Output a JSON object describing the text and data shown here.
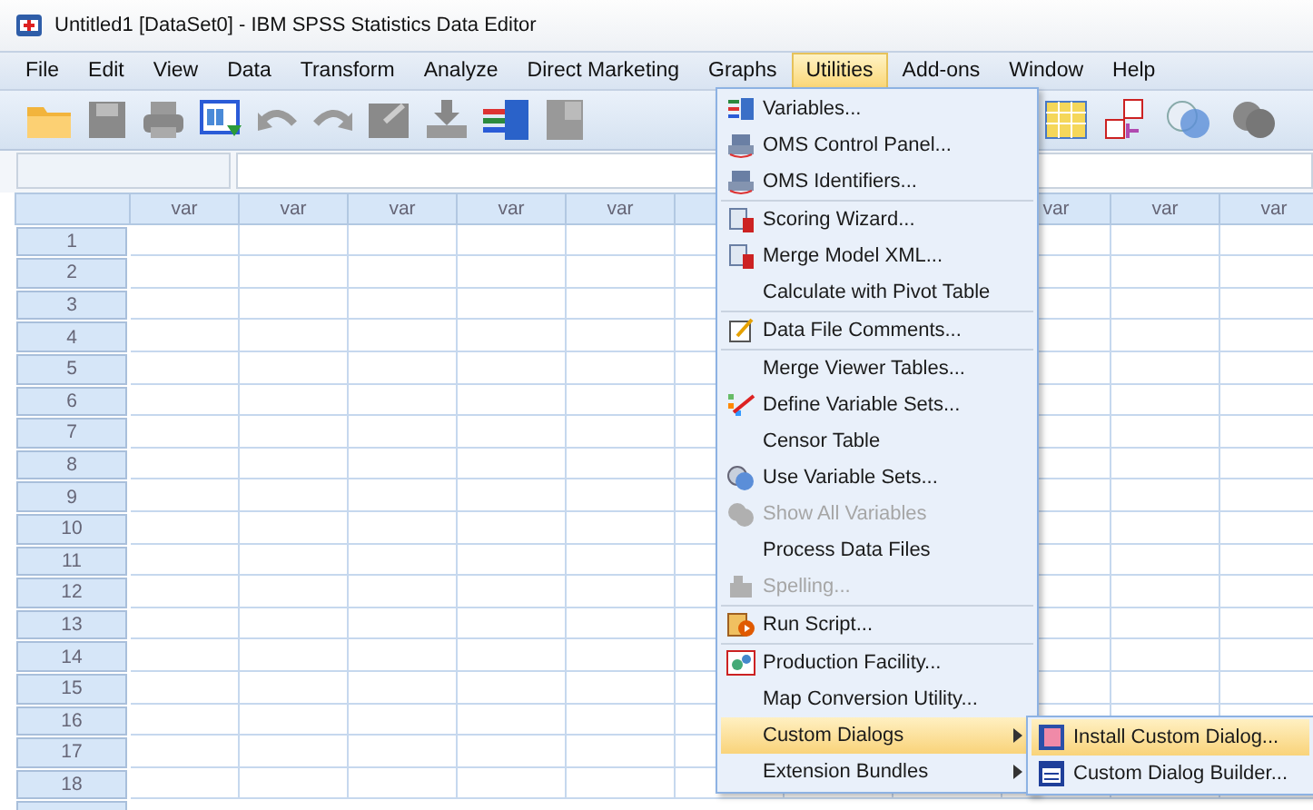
{
  "window": {
    "title": "Untitled1 [DataSet0] - IBM SPSS Statistics Data Editor"
  },
  "menubar": [
    {
      "label": "File",
      "selected": false
    },
    {
      "label": "Edit",
      "selected": false
    },
    {
      "label": "View",
      "selected": false
    },
    {
      "label": "Data",
      "selected": false
    },
    {
      "label": "Transform",
      "selected": false
    },
    {
      "label": "Analyze",
      "selected": false
    },
    {
      "label": "Direct Marketing",
      "selected": false
    },
    {
      "label": "Graphs",
      "selected": false
    },
    {
      "label": "Utilities",
      "selected": true
    },
    {
      "label": "Add-ons",
      "selected": false
    },
    {
      "label": "Window",
      "selected": false
    },
    {
      "label": "Help",
      "selected": false
    }
  ],
  "grid": {
    "columns_left": [
      "var",
      "var",
      "var",
      "var",
      "var"
    ],
    "columns_right": [
      "var",
      "var",
      "var"
    ],
    "rows": [
      "1",
      "2",
      "3",
      "4",
      "5",
      "6",
      "7",
      "8",
      "9",
      "10",
      "11",
      "12",
      "13",
      "14",
      "15",
      "16",
      "17",
      "18"
    ]
  },
  "utilities_menu": {
    "sections": [
      [
        {
          "label": "Variables...",
          "has_icon": true,
          "disabled": false,
          "selected": false,
          "submenu": false
        },
        {
          "label": "OMS Control Panel...",
          "has_icon": true,
          "disabled": false,
          "selected": false,
          "submenu": false
        },
        {
          "label": "OMS Identifiers...",
          "has_icon": true,
          "disabled": false,
          "selected": false,
          "submenu": false
        }
      ],
      [
        {
          "label": "Scoring Wizard...",
          "has_icon": true,
          "disabled": false,
          "selected": false,
          "submenu": false
        },
        {
          "label": "Merge Model XML...",
          "has_icon": true,
          "disabled": false,
          "selected": false,
          "submenu": false
        },
        {
          "label": "Calculate with Pivot Table",
          "has_icon": false,
          "disabled": false,
          "selected": false,
          "submenu": false
        }
      ],
      [
        {
          "label": "Data File Comments...",
          "has_icon": true,
          "disabled": false,
          "selected": false,
          "submenu": false
        }
      ],
      [
        {
          "label": "Merge Viewer Tables...",
          "has_icon": false,
          "disabled": false,
          "selected": false,
          "submenu": false
        },
        {
          "label": "Define Variable Sets...",
          "has_icon": true,
          "disabled": false,
          "selected": false,
          "submenu": false
        },
        {
          "label": "Censor Table",
          "has_icon": false,
          "disabled": false,
          "selected": false,
          "submenu": false
        },
        {
          "label": "Use Variable Sets...",
          "has_icon": true,
          "disabled": false,
          "selected": false,
          "submenu": false
        },
        {
          "label": "Show All Variables",
          "has_icon": true,
          "disabled": true,
          "selected": false,
          "submenu": false
        },
        {
          "label": "Process Data Files",
          "has_icon": false,
          "disabled": false,
          "selected": false,
          "submenu": false
        },
        {
          "label": "Spelling...",
          "has_icon": true,
          "disabled": true,
          "selected": false,
          "submenu": false
        }
      ],
      [
        {
          "label": "Run Script...",
          "has_icon": true,
          "disabled": false,
          "selected": false,
          "submenu": false
        }
      ],
      [
        {
          "label": "Production Facility...",
          "has_icon": true,
          "disabled": false,
          "selected": false,
          "submenu": false
        },
        {
          "label": "Map Conversion Utility...",
          "has_icon": false,
          "disabled": false,
          "selected": false,
          "submenu": false
        },
        {
          "label": "Custom Dialogs",
          "has_icon": false,
          "disabled": false,
          "selected": true,
          "submenu": true
        },
        {
          "label": "Extension Bundles",
          "has_icon": false,
          "disabled": false,
          "selected": false,
          "submenu": true
        }
      ]
    ]
  },
  "custom_dialogs_submenu": [
    {
      "label": "Install Custom Dialog...",
      "selected": true
    },
    {
      "label": "Custom Dialog Builder...",
      "selected": false
    }
  ]
}
